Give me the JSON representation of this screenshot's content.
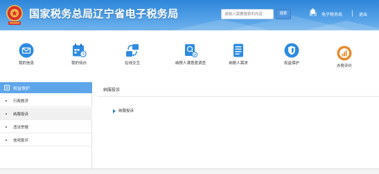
{
  "header": {
    "title": "国家税务总局辽宁省电子税务局",
    "search_placeholder": "请输入需要搜索的内容",
    "search_button": "搜索",
    "home_link": "首页",
    "guide_link": "电子税务局",
    "logout_link": "退出"
  },
  "nav": {
    "items": [
      {
        "label": "我的信息",
        "icon": "envelope-icon",
        "color": "#2d8be0"
      },
      {
        "label": "我的待办",
        "icon": "calendar-icon",
        "color": "#2d8be0"
      },
      {
        "label": "在线交互",
        "icon": "arrows-icon",
        "color": "#2d8be0"
      },
      {
        "label": "纳税人满意度调查",
        "icon": "survey-icon",
        "color": "#2d8be0"
      },
      {
        "label": "纳税人需求",
        "icon": "document-list-icon",
        "color": "#2d8be0"
      },
      {
        "label": "权益保护",
        "icon": "shield-icon",
        "color": "#2d8be0"
      },
      {
        "label": "办税评价",
        "icon": "rating-icon",
        "color": "#e8892a"
      }
    ]
  },
  "sidebar": {
    "heading": "权益保护",
    "items": [
      {
        "label": "行政救济",
        "active": false
      },
      {
        "label": "纳服投诉",
        "active": true
      },
      {
        "label": "违法举报",
        "active": false
      },
      {
        "label": "信用复评",
        "active": false
      }
    ]
  },
  "main": {
    "title": "纳服投诉",
    "tree_item": "纳服投诉"
  },
  "colors": {
    "banner": "#3d93df",
    "accent": "#2d8be0",
    "sidebar_head": "#5ea6ea",
    "rating_orange": "#e8892a"
  }
}
